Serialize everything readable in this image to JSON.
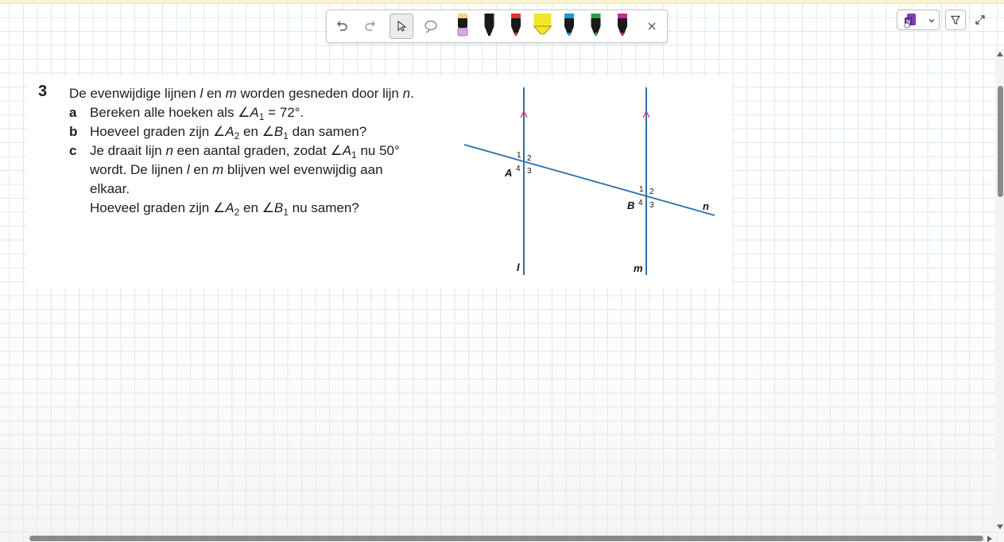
{
  "exercise": {
    "number": "3",
    "intro": {
      "pre": "De evenwijdige lijnen ",
      "l": "l",
      "mid1": " en ",
      "m": "m",
      "mid2": " worden gesneden door lijn ",
      "n": "n",
      "end": "."
    },
    "a": {
      "label": "a",
      "pre": "Bereken alle hoeken als ∠",
      "var": "A",
      "sub": "1",
      "post": " = 72°."
    },
    "b": {
      "label": "b",
      "pre": "Hoeveel graden zijn ∠",
      "var1": "A",
      "sub1": "2",
      "mid": " en ∠",
      "var2": "B",
      "sub2": "1",
      "post": " dan samen?"
    },
    "c": {
      "label": "c",
      "line1_pre": "Je draait lijn ",
      "line1_n": "n",
      "line1_mid": " een aantal graden, zodat ∠",
      "line1_var": "A",
      "line1_sub": "1",
      "line1_post": " nu 50°",
      "line2_pre": "wordt. De lijnen ",
      "line2_l": "l",
      "line2_mid": " en ",
      "line2_m": "m",
      "line2_post": " blijven wel evenwijdig aan",
      "line3": "elkaar.",
      "line4_pre": "Hoeveel graden zijn ∠",
      "line4_var1": "A",
      "line4_sub1": "2",
      "line4_mid": " en ∠",
      "line4_var2": "B",
      "line4_sub2": "1",
      "line4_post": " nu samen?"
    }
  },
  "diagram": {
    "point_a": "A",
    "point_b": "B",
    "line_l": "l",
    "line_m": "m",
    "line_n": "n",
    "angles_a": [
      "1",
      "2",
      "3",
      "4"
    ],
    "angles_b": [
      "1",
      "2",
      "3",
      "4"
    ],
    "line_color": "#2a6fae",
    "arrow_color": "#d23c6a"
  },
  "toolbar": {
    "tools": [
      "undo-icon",
      "redo-icon",
      "pointer-icon",
      "lasso-icon"
    ],
    "pens": [
      {
        "name": "pen-pink-black",
        "color": "#1a1a1a",
        "tip": "#d9a7e6"
      },
      {
        "name": "pen-black",
        "color": "#1a1a1a",
        "tip": "#1a1a1a"
      },
      {
        "name": "pen-red",
        "color": "#e0343b",
        "tip": "#1a1a1a"
      },
      {
        "name": "highlighter-yellow",
        "color": "#f4e526",
        "tip": "#f4e526"
      },
      {
        "name": "pen-blue",
        "color": "#1a9ad6",
        "tip": "#1a1a1a"
      },
      {
        "name": "pen-green",
        "color": "#22a04a",
        "tip": "#1a1a1a"
      },
      {
        "name": "pen-magenta",
        "color": "#d0249b",
        "tip": "#1a1a1a"
      }
    ]
  },
  "colors": {
    "grid": "#dbe8f1",
    "accent": "#6b3fa0"
  }
}
